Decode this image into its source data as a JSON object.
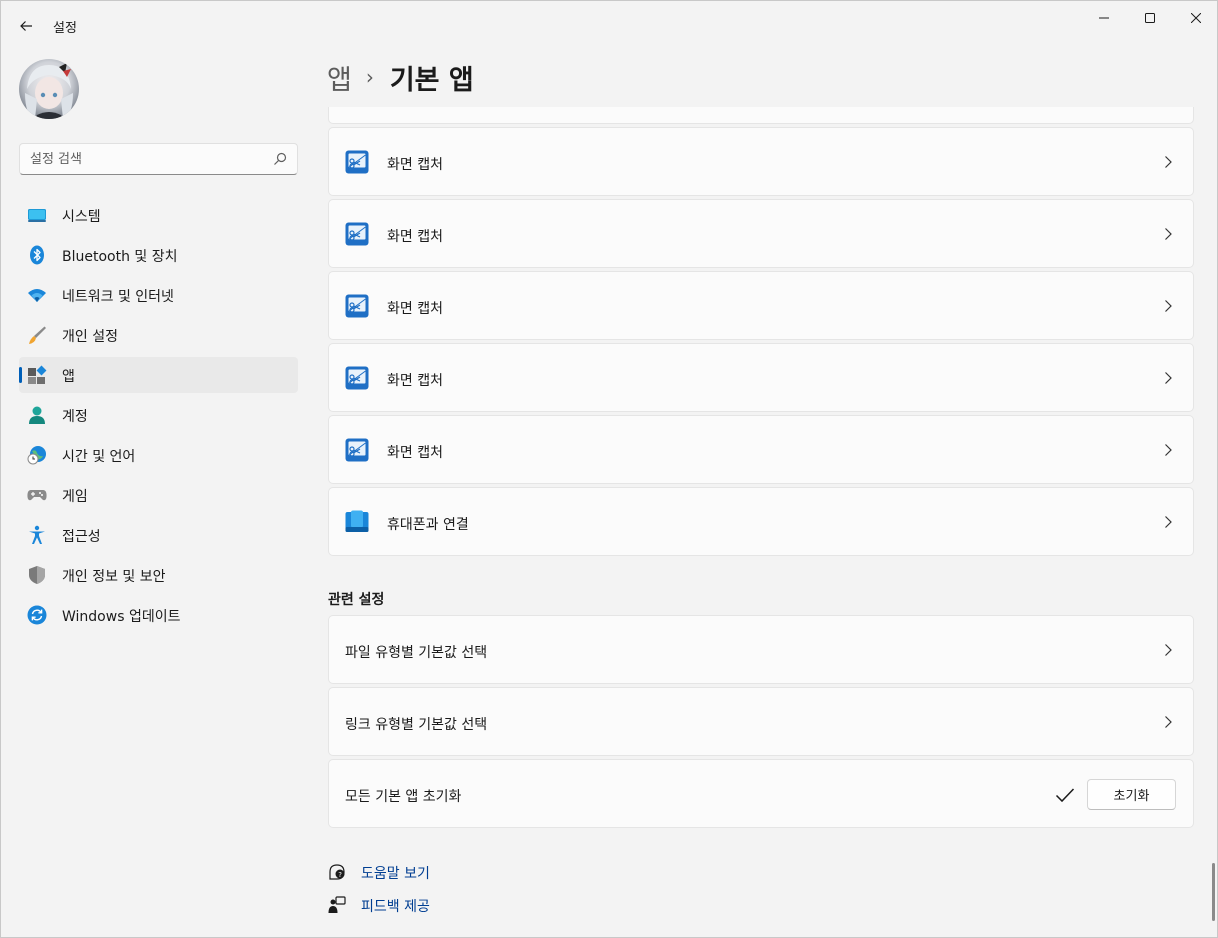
{
  "window": {
    "title": "설정",
    "accent": "#005fb8",
    "controls": [
      "minimize-icon",
      "maximize-icon",
      "close-icon"
    ]
  },
  "sidebar": {
    "search_placeholder": "설정 검색",
    "items": [
      {
        "label": "시스템",
        "icon": "system-icon"
      },
      {
        "label": "Bluetooth 및 장치",
        "icon": "bluetooth-icon"
      },
      {
        "label": "네트워크 및 인터넷",
        "icon": "wifi-icon"
      },
      {
        "label": "개인 설정",
        "icon": "brush-icon"
      },
      {
        "label": "앱",
        "icon": "apps-icon",
        "selected": true
      },
      {
        "label": "계정",
        "icon": "account-icon"
      },
      {
        "label": "시간 및 언어",
        "icon": "time-language-icon"
      },
      {
        "label": "게임",
        "icon": "gamepad-icon"
      },
      {
        "label": "접근성",
        "icon": "accessibility-icon"
      },
      {
        "label": "개인 정보 및 보안",
        "icon": "shield-icon"
      },
      {
        "label": "Windows 업데이트",
        "icon": "update-icon"
      }
    ]
  },
  "breadcrumb": {
    "parent": "앱",
    "separator": "›",
    "current": "기본 앱"
  },
  "apps": [
    {
      "label": "화면 캡처",
      "icon": "snipping-tool-icon"
    },
    {
      "label": "화면 캡처",
      "icon": "snipping-tool-icon"
    },
    {
      "label": "화면 캡처",
      "icon": "snipping-tool-icon"
    },
    {
      "label": "화면 캡처",
      "icon": "snipping-tool-icon"
    },
    {
      "label": "화면 캡처",
      "icon": "snipping-tool-icon"
    },
    {
      "label": "휴대폰과 연결",
      "icon": "phone-link-icon"
    }
  ],
  "related": {
    "title": "관련 설정",
    "items": [
      {
        "label": "파일 유형별 기본값 선택"
      },
      {
        "label": "링크 유형별 기본값 선택"
      }
    ],
    "reset": {
      "label": "모든 기본 앱 초기화",
      "button": "초기화",
      "status_icon": "check-icon"
    }
  },
  "footer_links": [
    {
      "label": "도움말 보기",
      "icon": "help-icon"
    },
    {
      "label": "피드백 제공",
      "icon": "feedback-icon"
    }
  ]
}
